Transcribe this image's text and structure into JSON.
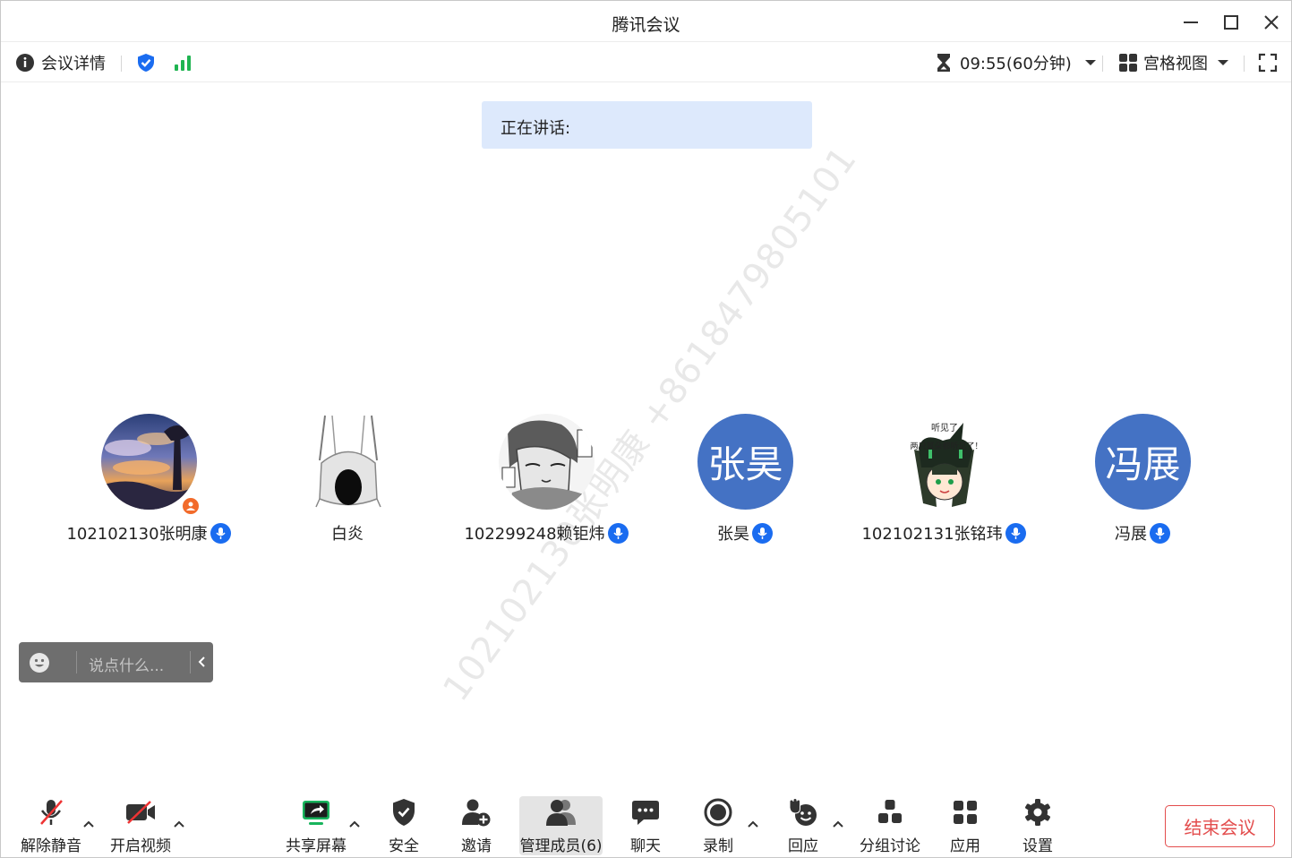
{
  "window": {
    "title": "腾讯会议"
  },
  "infobar": {
    "meeting_details": "会议详情",
    "timer": "09:55(60分钟)",
    "view_mode": "宫格视图"
  },
  "speaking": {
    "label": "正在讲话:"
  },
  "watermark": {
    "text": "102102130张明康 +8618479805101"
  },
  "participants": [
    {
      "name": "102102130张明康",
      "avatar": "photo-landscape",
      "host": true
    },
    {
      "name": "白炎",
      "avatar": "photo-robot"
    },
    {
      "name": "102299248赖钜炜",
      "avatar": "photo-manga"
    },
    {
      "name": "张昊",
      "avatar_text": "张昊"
    },
    {
      "name": "102102131张铭玮",
      "avatar": "photo-anime",
      "avatar_caption_1": "听见了",
      "avatar_caption_2": "两只耳朵都听见了！"
    },
    {
      "name": "冯展",
      "avatar_text": "冯展"
    }
  ],
  "chat": {
    "placeholder": "说点什么..."
  },
  "toolbar": {
    "unmute": "解除静音",
    "start_video": "开启视频",
    "share_screen": "共享屏幕",
    "security": "安全",
    "invite": "邀请",
    "manage_members": "管理成员(6)",
    "chat": "聊天",
    "record": "录制",
    "reactions": "回应",
    "breakout": "分组讨论",
    "apps": "应用",
    "settings": "设置",
    "end_meeting": "结束会议"
  },
  "colors": {
    "accent_blue": "#1a6cf0",
    "avatar_blue": "#4472c4",
    "end_red": "#e34d4d",
    "signal_green": "#1fb451",
    "share_green": "#18b45c",
    "speaking_bg": "#dde9fc"
  }
}
